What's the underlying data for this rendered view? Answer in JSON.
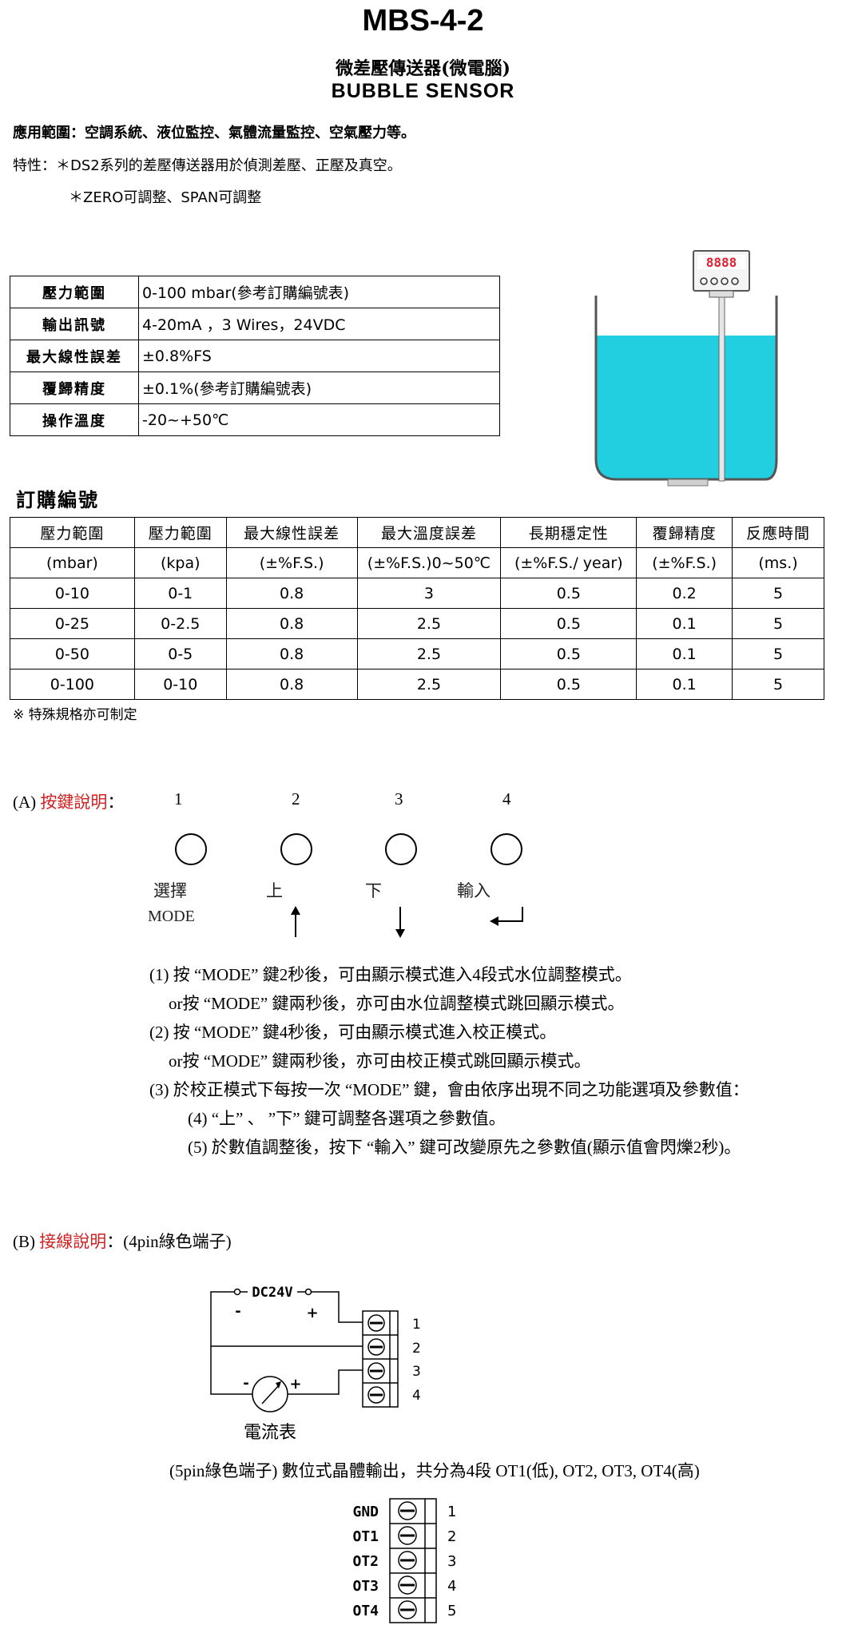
{
  "header": {
    "title": "MBS-4-2",
    "subtitle": "微差壓傳送器(微電腦)",
    "subtitle_en": "BUBBLE  SENSOR"
  },
  "intro": {
    "application": "應用範圍：空調系統、液位監控、氣體流量監控、空氣壓力等。",
    "feature1": "特性：＊DS2系列的差壓傳送器用於偵測差壓、正壓及真空。",
    "feature2": "＊ZERO可調整、SPAN可調整"
  },
  "spec_table": [
    {
      "key": "壓力範圍",
      "value": "0-100 mbar(參考訂購編號表)"
    },
    {
      "key": "輸出訊號",
      "value": "4-20mA ，3 Wires，24VDC"
    },
    {
      "key": "最大線性誤差",
      "value": "±0.8%FS"
    },
    {
      "key": "覆歸精度",
      "value": "±0.1%(參考訂購編號表)"
    },
    {
      "key": "操作溫度",
      "value": "-20~+50℃"
    }
  ],
  "device_display": "8888",
  "order": {
    "title": "訂購編號",
    "headers": [
      "壓力範圍",
      "壓力範圍",
      "最大線性誤差",
      "最大溫度誤差",
      "長期穩定性",
      "覆歸精度",
      "反應時間"
    ],
    "units": [
      "(mbar)",
      "(kpa)",
      "(±%F.S.)",
      "(±%F.S.)0~50℃",
      "(±%F.S./ year)",
      "(±%F.S.)",
      "(ms.)"
    ],
    "rows": [
      [
        "0-10",
        "0-1",
        "0.8",
        "3",
        "0.5",
        "0.2",
        "5"
      ],
      [
        "0-25",
        "0-2.5",
        "0.8",
        "2.5",
        "0.5",
        "0.1",
        "5"
      ],
      [
        "0-50",
        "0-5",
        "0.8",
        "2.5",
        "0.5",
        "0.1",
        "5"
      ],
      [
        "0-100",
        "0-10",
        "0.8",
        "2.5",
        "0.5",
        "0.1",
        "5"
      ]
    ],
    "note": "※ 特殊規格亦可制定"
  },
  "section_a": {
    "prefix": "(A) ",
    "title": "按鍵說明",
    "suffix": "：",
    "keys": [
      {
        "num": "1",
        "label": "選擇",
        "sub": "MODE"
      },
      {
        "num": "2",
        "label": "上"
      },
      {
        "num": "3",
        "label": "下"
      },
      {
        "num": "4",
        "label": "輸入"
      }
    ],
    "instructions": [
      "(1)  按 “MODE” 鍵2秒後，可由顯示模式進入4段式水位調整模式。",
      "or按 “MODE” 鍵兩秒後，亦可由水位調整模式跳回顯示模式。",
      "(2)  按 “MODE” 鍵4秒後，可由顯示模式進入校正模式。",
      "or按 “MODE” 鍵兩秒後，亦可由校正模式跳回顯示模式。",
      "(3)  於校正模式下每按一次 “MODE” 鍵，會由依序出現不同之功能選項及參數值：",
      "(4)  “上” 、 ”下” 鍵可調整各選項之參數值。",
      "(5)  於數值調整後，按下 “輸入” 鍵可改變原先之參數值(顯示值會閃爍2秒)。"
    ]
  },
  "section_b": {
    "prefix": "(B) ",
    "title": "接線說明",
    "suffix": "：(4pin綠色端子)",
    "power_label": "DC24V",
    "minus": "-",
    "plus": "+",
    "meter_label": "電流表",
    "terminal_numbers": [
      "1",
      "2",
      "3",
      "4"
    ],
    "output_note": "(5pin綠色端子)  數位式晶體輸出，共分為4段 OT1(低), OT2, OT3, OT4(高)",
    "outputs": [
      {
        "label": "GND",
        "num": "1"
      },
      {
        "label": "OT1",
        "num": "2"
      },
      {
        "label": "OT2",
        "num": "3"
      },
      {
        "label": "OT3",
        "num": "4"
      },
      {
        "label": "OT4",
        "num": "5"
      }
    ]
  },
  "colors": {
    "water": "#22cfe0",
    "red_text": "#d02020",
    "device_red": "#e02030"
  }
}
